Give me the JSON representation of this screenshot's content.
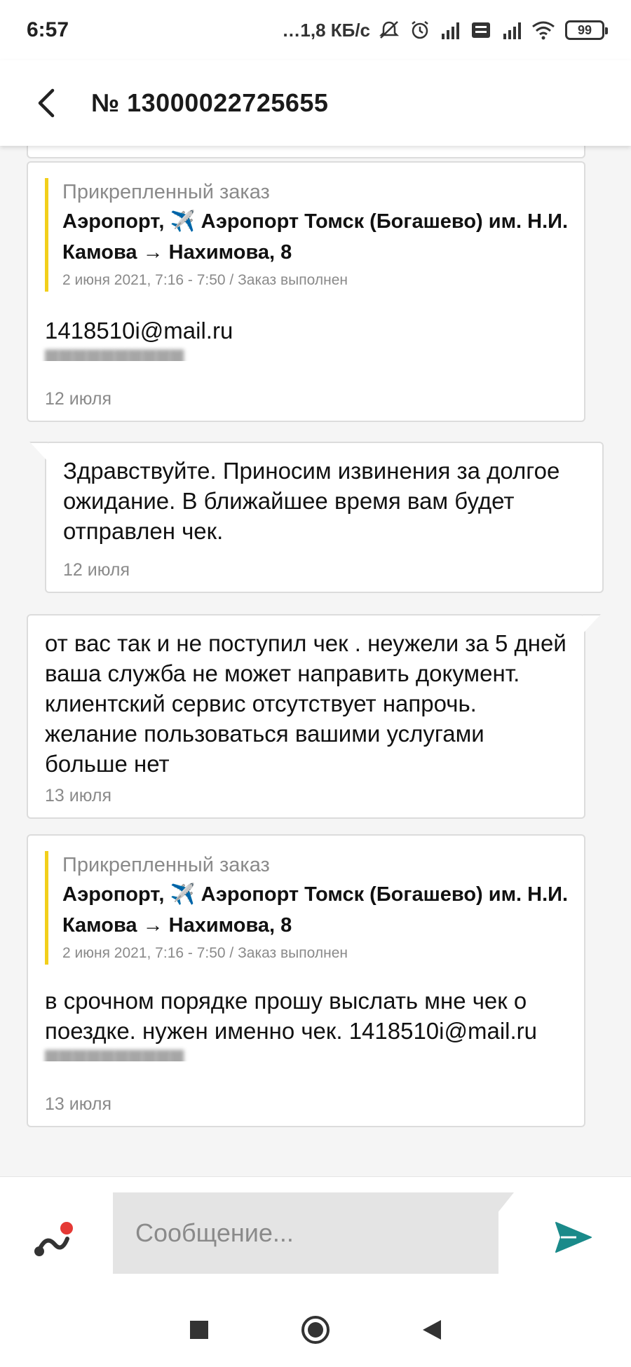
{
  "status_bar": {
    "time": "6:57",
    "network_speed": "…1,8 КБ/с",
    "battery": "99"
  },
  "header": {
    "title": "№ 13000022725655"
  },
  "messages": [
    {
      "attached_order": {
        "label": "Прикрепленный заказ",
        "route": "Аэропорт, ✈️ Аэропорт Томск (Богашево) им. Н.И. Камова → Нахимова, 8",
        "meta": "2 июня 2021, 7:16 - 7:50 / Заказ выполнен"
      },
      "text": "1418510i@mail.ru",
      "date": "12 июля"
    },
    {
      "text": "Здравствуйте. Приносим извинения за долгое ожидание. В ближайшее время вам будет отправлен чек.",
      "date": "12 июля"
    },
    {
      "text": "от вас так и не поступил чек . неужели за 5 дней ваша служба не может направить документ. клиентский сервис отсутствует напрочь. желание пользоваться вашими услугами больше нет",
      "date": "13 июля"
    },
    {
      "attached_order": {
        "label": "Прикрепленный заказ",
        "route": "Аэропорт, ✈️ Аэропорт Томск (Богашево) им. Н.И. Камова → Нахимова, 8",
        "meta": "2 июня 2021, 7:16 - 7:50 / Заказ выполнен"
      },
      "text": "в срочном порядке прошу выслать мне чек о поездке. нужен именно чек. 1418510i@mail.ru",
      "date": "13 июля"
    }
  ],
  "composer": {
    "placeholder": "Сообщение..."
  },
  "colors": {
    "accent_send": "#1a8a8a",
    "attach_accent": "#e53935",
    "order_bar": "#f2cf1b"
  },
  "icons": {
    "back": "arrow-left-icon",
    "attach": "attach-icon",
    "send": "send-icon",
    "nav_recents": "square-icon",
    "nav_home": "circle-icon",
    "nav_back": "triangle-back-icon"
  }
}
